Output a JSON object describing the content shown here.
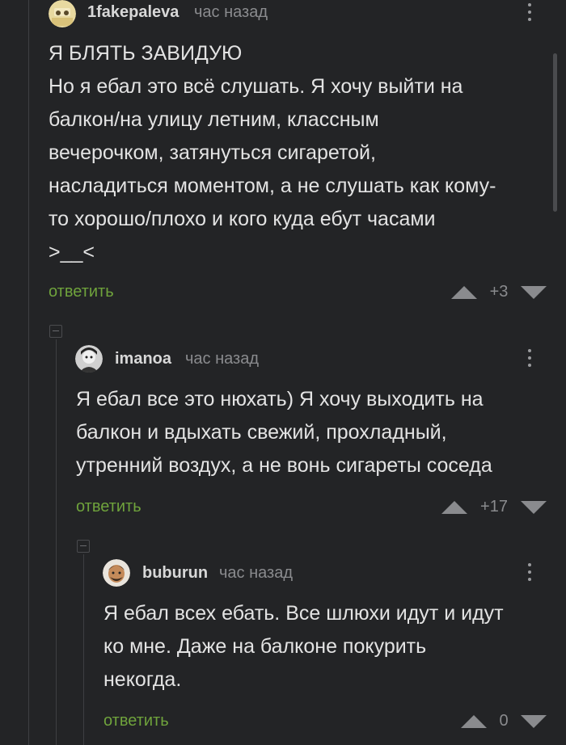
{
  "comments": [
    {
      "username": "1fakepaleva",
      "time": "час назад",
      "lines": [
        "Я БЛЯТЬ ЗАВИДУЮ",
        "Но я ебал это всё слушать. Я хочу выйти на",
        "балкон/на улицу летним, классным",
        "вечерочком, затянуться сигаретой,",
        "насладиться моментом, а не слушать как кому-",
        "то хорошо/плохо и кого куда ебут часами",
        ">__<"
      ],
      "reply_label": "ответить",
      "rating": "+3"
    },
    {
      "username": "imanoa",
      "time": "час назад",
      "lines": [
        "Я ебал все это нюхать) Я хочу выходить на",
        "балкон и вдыхать свежий, прохладный,",
        "утренний воздух, а не вонь сигареты соседа"
      ],
      "reply_label": "ответить",
      "rating": "+17"
    },
    {
      "username": "buburun",
      "time": "час назад",
      "lines": [
        "Я ебал всех ебать. Все шлюхи идут и идут",
        "ко мне. Даже на балконе покурить",
        "некогда."
      ],
      "reply_label": "ответить",
      "rating": "0"
    }
  ],
  "colors": {
    "background": "#232426",
    "reply_link": "#6fa33c",
    "muted": "#8a8b8e"
  },
  "icons": {
    "upvote": "triangle-up-icon",
    "downvote": "triangle-down-icon",
    "menu": "kebab-menu-icon",
    "collapse": "collapse-minus-icon"
  }
}
